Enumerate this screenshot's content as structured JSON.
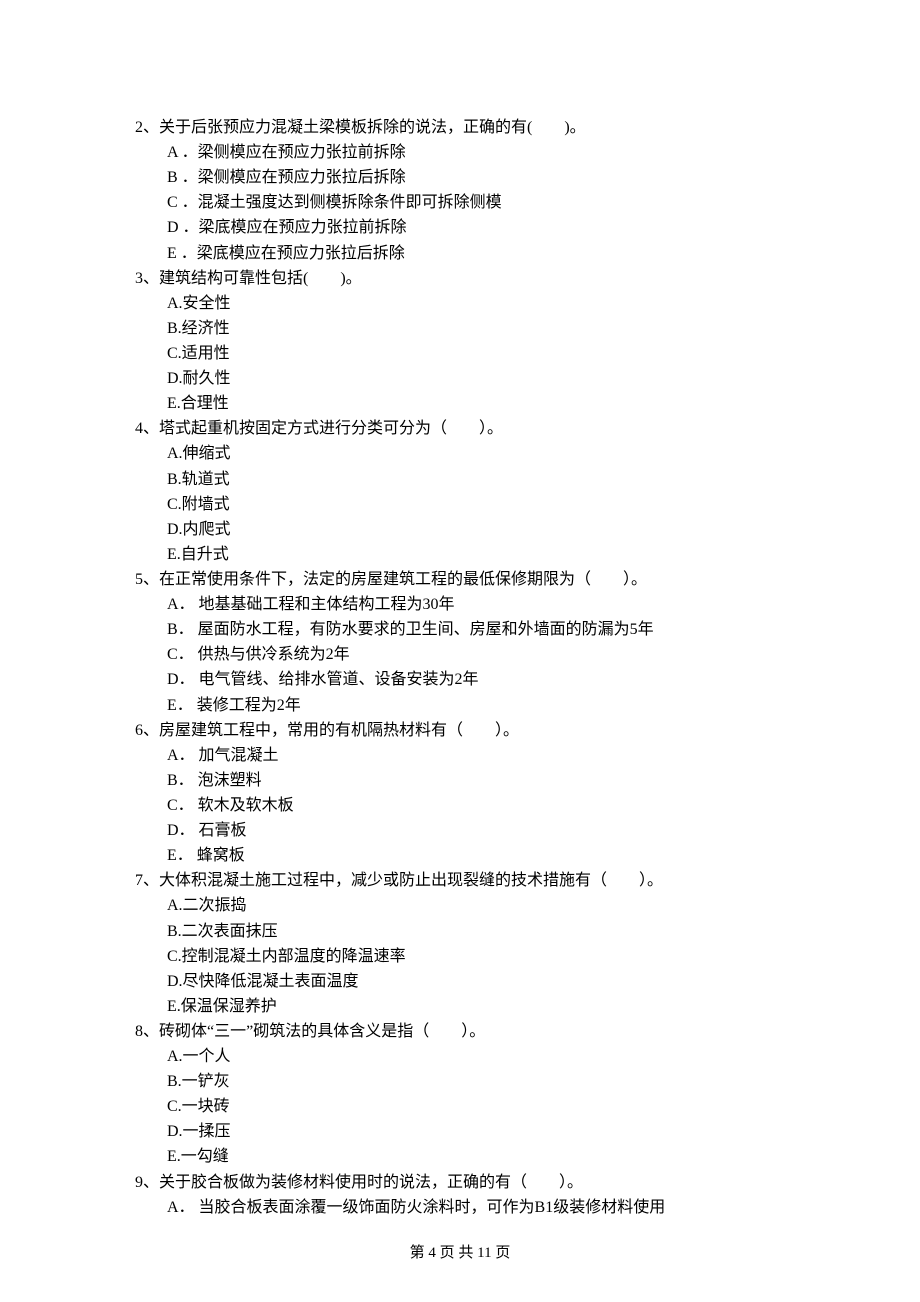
{
  "questions": [
    {
      "num": "2、",
      "stem": "关于后张预应力混凝土梁模板拆除的说法，正确的有(　　)。",
      "options": [
        "A ．梁侧模应在预应力张拉前拆除",
        "B ．梁侧模应在预应力张拉后拆除",
        "C ．混凝土强度达到侧模拆除条件即可拆除侧模",
        "D ．梁底模应在预应力张拉前拆除",
        "E ．梁底模应在预应力张拉后拆除"
      ]
    },
    {
      "num": "3、",
      "stem": "建筑结构可靠性包括(　　)。",
      "options": [
        "A.安全性",
        "B.经济性",
        "C.适用性",
        "D.耐久性",
        "E.合理性"
      ]
    },
    {
      "num": "4、",
      "stem": "塔式起重机按固定方式进行分类可分为（　　）。",
      "options": [
        "A.伸缩式",
        "B.轨道式",
        "C.附墙式",
        "D.内爬式",
        "E.自升式"
      ]
    },
    {
      "num": "5、",
      "stem": "在正常使用条件下，法定的房屋建筑工程的最低保修期限为（　　）。",
      "options": [
        "A． 地基基础工程和主体结构工程为30年",
        "B． 屋面防水工程，有防水要求的卫生间、房屋和外墙面的防漏为5年",
        "C． 供热与供冷系统为2年",
        "D． 电气管线、给排水管道、设备安装为2年",
        "E． 装修工程为2年"
      ]
    },
    {
      "num": "6、",
      "stem": "房屋建筑工程中，常用的有机隔热材料有（　　）。",
      "options": [
        "A． 加气混凝土",
        "B． 泡沫塑料",
        "C． 软木及软木板",
        "D． 石膏板",
        "E． 蜂窝板"
      ]
    },
    {
      "num": "7、",
      "stem": "大体积混凝土施工过程中，减少或防止出现裂缝的技术措施有（　　）。",
      "options": [
        "A.二次振捣",
        "B.二次表面抹压",
        "C.控制混凝土内部温度的降温速率",
        "D.尽快降低混凝土表面温度",
        "E.保温保湿养护"
      ]
    },
    {
      "num": "8、",
      "stem": "砖砌体“三一”砌筑法的具体含义是指（　　）。",
      "options": [
        "A.一个人",
        "B.一铲灰",
        "C.一块砖",
        "D.一揉压",
        "E.一勾缝"
      ]
    },
    {
      "num": "9、",
      "stem": "关于胶合板做为装修材料使用时的说法，正确的有（　　）。",
      "options": [
        "A． 当胶合板表面涂覆一级饰面防火涂料时，可作为B1级装修材料使用"
      ]
    }
  ],
  "footer": "第 4 页 共 11 页"
}
